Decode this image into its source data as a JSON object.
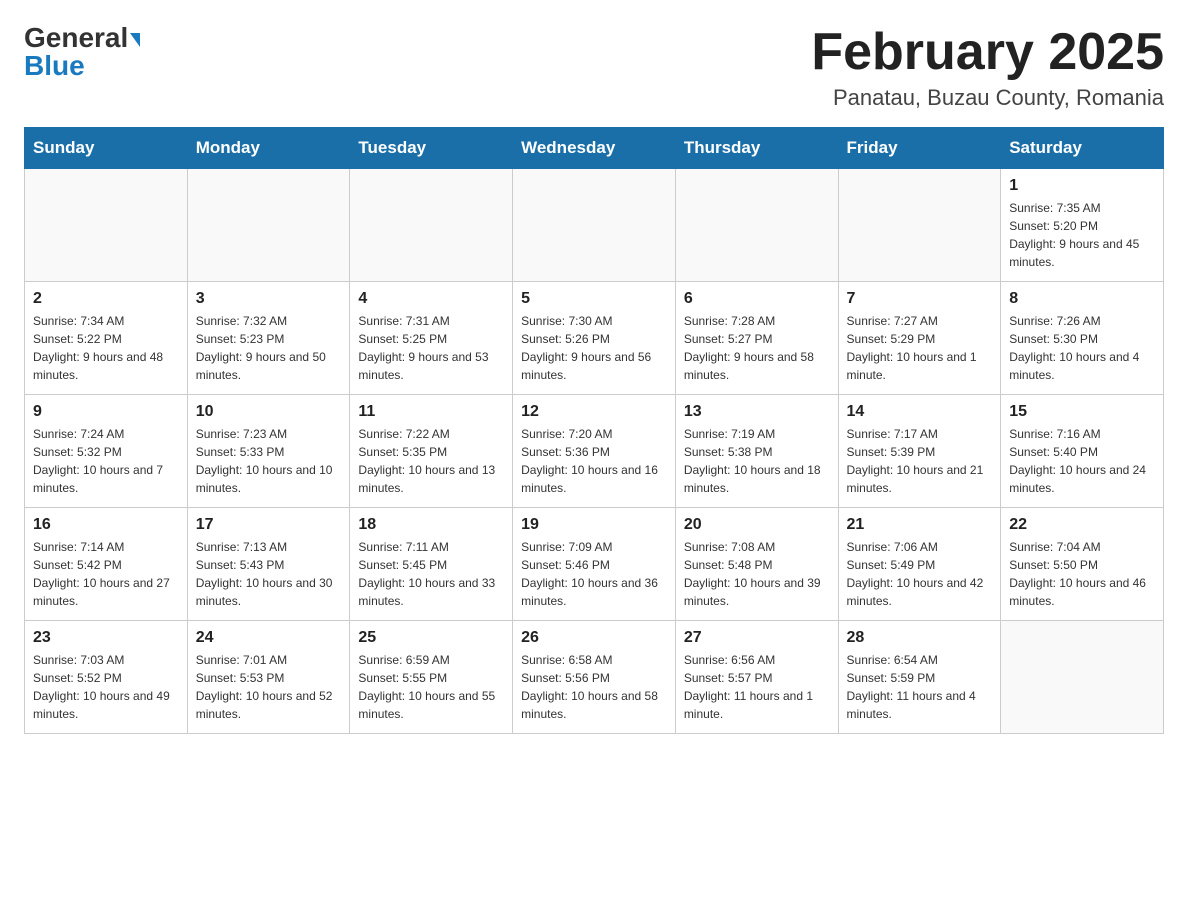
{
  "header": {
    "logo_general": "General",
    "logo_blue": "Blue",
    "month_title": "February 2025",
    "location": "Panatau, Buzau County, Romania"
  },
  "weekdays": [
    "Sunday",
    "Monday",
    "Tuesday",
    "Wednesday",
    "Thursday",
    "Friday",
    "Saturday"
  ],
  "weeks": [
    [
      {
        "day": "",
        "info": ""
      },
      {
        "day": "",
        "info": ""
      },
      {
        "day": "",
        "info": ""
      },
      {
        "day": "",
        "info": ""
      },
      {
        "day": "",
        "info": ""
      },
      {
        "day": "",
        "info": ""
      },
      {
        "day": "1",
        "info": "Sunrise: 7:35 AM\nSunset: 5:20 PM\nDaylight: 9 hours and 45 minutes."
      }
    ],
    [
      {
        "day": "2",
        "info": "Sunrise: 7:34 AM\nSunset: 5:22 PM\nDaylight: 9 hours and 48 minutes."
      },
      {
        "day": "3",
        "info": "Sunrise: 7:32 AM\nSunset: 5:23 PM\nDaylight: 9 hours and 50 minutes."
      },
      {
        "day": "4",
        "info": "Sunrise: 7:31 AM\nSunset: 5:25 PM\nDaylight: 9 hours and 53 minutes."
      },
      {
        "day": "5",
        "info": "Sunrise: 7:30 AM\nSunset: 5:26 PM\nDaylight: 9 hours and 56 minutes."
      },
      {
        "day": "6",
        "info": "Sunrise: 7:28 AM\nSunset: 5:27 PM\nDaylight: 9 hours and 58 minutes."
      },
      {
        "day": "7",
        "info": "Sunrise: 7:27 AM\nSunset: 5:29 PM\nDaylight: 10 hours and 1 minute."
      },
      {
        "day": "8",
        "info": "Sunrise: 7:26 AM\nSunset: 5:30 PM\nDaylight: 10 hours and 4 minutes."
      }
    ],
    [
      {
        "day": "9",
        "info": "Sunrise: 7:24 AM\nSunset: 5:32 PM\nDaylight: 10 hours and 7 minutes."
      },
      {
        "day": "10",
        "info": "Sunrise: 7:23 AM\nSunset: 5:33 PM\nDaylight: 10 hours and 10 minutes."
      },
      {
        "day": "11",
        "info": "Sunrise: 7:22 AM\nSunset: 5:35 PM\nDaylight: 10 hours and 13 minutes."
      },
      {
        "day": "12",
        "info": "Sunrise: 7:20 AM\nSunset: 5:36 PM\nDaylight: 10 hours and 16 minutes."
      },
      {
        "day": "13",
        "info": "Sunrise: 7:19 AM\nSunset: 5:38 PM\nDaylight: 10 hours and 18 minutes."
      },
      {
        "day": "14",
        "info": "Sunrise: 7:17 AM\nSunset: 5:39 PM\nDaylight: 10 hours and 21 minutes."
      },
      {
        "day": "15",
        "info": "Sunrise: 7:16 AM\nSunset: 5:40 PM\nDaylight: 10 hours and 24 minutes."
      }
    ],
    [
      {
        "day": "16",
        "info": "Sunrise: 7:14 AM\nSunset: 5:42 PM\nDaylight: 10 hours and 27 minutes."
      },
      {
        "day": "17",
        "info": "Sunrise: 7:13 AM\nSunset: 5:43 PM\nDaylight: 10 hours and 30 minutes."
      },
      {
        "day": "18",
        "info": "Sunrise: 7:11 AM\nSunset: 5:45 PM\nDaylight: 10 hours and 33 minutes."
      },
      {
        "day": "19",
        "info": "Sunrise: 7:09 AM\nSunset: 5:46 PM\nDaylight: 10 hours and 36 minutes."
      },
      {
        "day": "20",
        "info": "Sunrise: 7:08 AM\nSunset: 5:48 PM\nDaylight: 10 hours and 39 minutes."
      },
      {
        "day": "21",
        "info": "Sunrise: 7:06 AM\nSunset: 5:49 PM\nDaylight: 10 hours and 42 minutes."
      },
      {
        "day": "22",
        "info": "Sunrise: 7:04 AM\nSunset: 5:50 PM\nDaylight: 10 hours and 46 minutes."
      }
    ],
    [
      {
        "day": "23",
        "info": "Sunrise: 7:03 AM\nSunset: 5:52 PM\nDaylight: 10 hours and 49 minutes."
      },
      {
        "day": "24",
        "info": "Sunrise: 7:01 AM\nSunset: 5:53 PM\nDaylight: 10 hours and 52 minutes."
      },
      {
        "day": "25",
        "info": "Sunrise: 6:59 AM\nSunset: 5:55 PM\nDaylight: 10 hours and 55 minutes."
      },
      {
        "day": "26",
        "info": "Sunrise: 6:58 AM\nSunset: 5:56 PM\nDaylight: 10 hours and 58 minutes."
      },
      {
        "day": "27",
        "info": "Sunrise: 6:56 AM\nSunset: 5:57 PM\nDaylight: 11 hours and 1 minute."
      },
      {
        "day": "28",
        "info": "Sunrise: 6:54 AM\nSunset: 5:59 PM\nDaylight: 11 hours and 4 minutes."
      },
      {
        "day": "",
        "info": ""
      }
    ]
  ]
}
